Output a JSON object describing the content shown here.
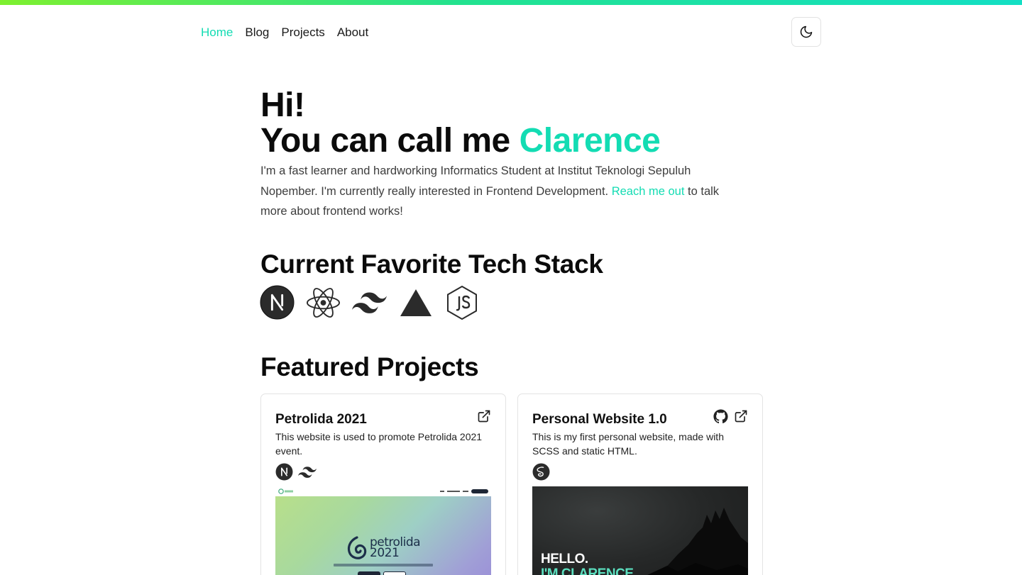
{
  "nav": {
    "items": [
      {
        "label": "Home",
        "active": true
      },
      {
        "label": "Blog",
        "active": false
      },
      {
        "label": "Projects",
        "active": false
      },
      {
        "label": "About",
        "active": false
      }
    ],
    "theme_toggle_icon": "moon-icon"
  },
  "hero": {
    "greeting": "Hi!",
    "intro_prefix": "You can call me ",
    "name": "Clarence",
    "bio_part1": "I'm a fast learner and hardworking Informatics Student at Institut Teknologi Sepuluh Nopember. I'm currently really interested in Frontend Development. ",
    "bio_link": "Reach me out",
    "bio_part2": " to talk more about frontend works!"
  },
  "tech_stack": {
    "title": "Current Favorite Tech Stack",
    "icons": [
      "nextjs-icon",
      "react-icon",
      "tailwindcss-icon",
      "vercel-icon",
      "nodejs-icon"
    ]
  },
  "featured": {
    "title": "Featured Projects",
    "projects": [
      {
        "title": "Petrolida 2021",
        "description": "This website is used to promote Petrolida 2021 event.",
        "stack_icons": [
          "nextjs-icon",
          "tailwindcss-icon"
        ],
        "actions": [
          "external-link-icon"
        ],
        "preview": {
          "brand": "petrolida",
          "year": "2021"
        }
      },
      {
        "title": "Personal Website 1.0",
        "description": "This is my first personal website, made with SCSS and static HTML.",
        "stack_icons": [
          "sass-icon"
        ],
        "actions": [
          "github-icon",
          "external-link-icon"
        ],
        "preview": {
          "line1": "HELLO.",
          "line2": "I'M CLARENCE"
        }
      }
    ]
  },
  "colors": {
    "accent": "#13dcb3",
    "gradient_start": "#7ef02f",
    "gradient_end": "#13dfc4",
    "text": "#111111"
  }
}
